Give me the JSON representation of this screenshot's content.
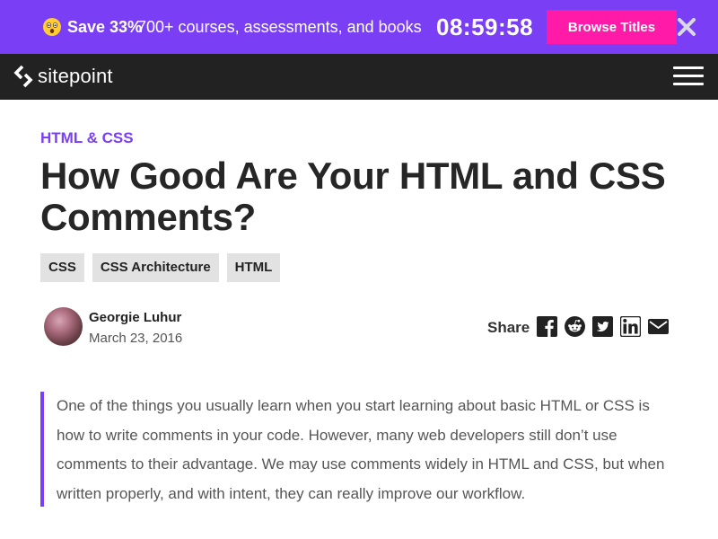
{
  "promo": {
    "emoji_icon": "astonished-face-icon",
    "save_text": "Save 33%",
    "offer_text": "700+ courses, assessments, and books",
    "timer": "08:59:58",
    "button_label": "Browse Titles",
    "close_icon": "close-icon",
    "bg_color": "#7a3ff5",
    "button_color": "#ff1aa8"
  },
  "header": {
    "logo_icon": "sitepoint-logo-icon",
    "logo_text": "sitepoint",
    "menu_icon": "hamburger-menu-icon",
    "bg_color": "#222222"
  },
  "article": {
    "category": "HTML & CSS",
    "title": "How Good Are Your HTML and CSS Comments?",
    "tags": [
      "CSS",
      "CSS Architecture",
      "HTML"
    ],
    "author": {
      "name": "Georgie Luhur",
      "date": "March 23, 2016"
    },
    "share": {
      "label": "Share",
      "icons": [
        "facebook-icon",
        "reddit-icon",
        "twitter-icon",
        "linkedin-icon",
        "email-icon"
      ]
    },
    "intro": "One of the things you usually learn when you start learning about basic HTML or CSS is how to write comments in your code. However, many web developers still don’t use comments to their advantage. We may use comments widely in HTML and CSS, but when written properly, and with intent, they can really improve our workflow.",
    "accent_color": "#7a3ff5"
  }
}
